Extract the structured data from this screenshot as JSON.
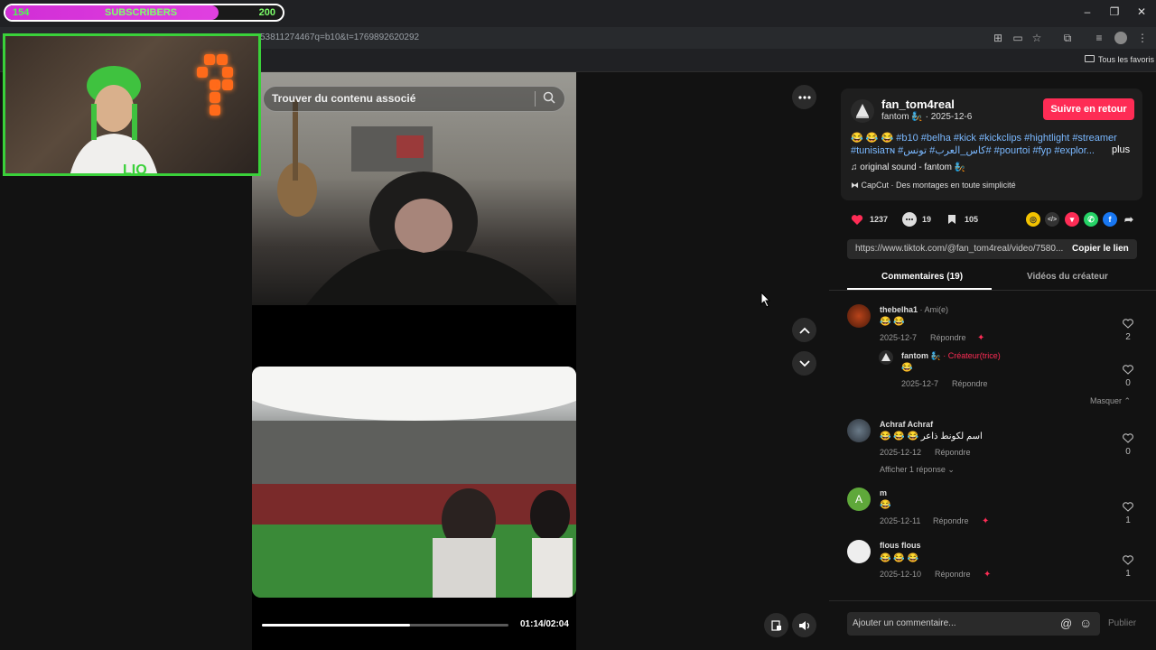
{
  "browser": {
    "url": "53811274467q=b10&t=1769892620292",
    "bookmarks_folder": "Tous les favoris"
  },
  "overlay": {
    "sub_count": "154",
    "sub_label": "SUBSCRIBERS",
    "sub_goal": "200",
    "sub_progress": 0.77
  },
  "search": {
    "placeholder": "Trouver du contenu associé"
  },
  "player": {
    "timecode": "01:14/02:04",
    "progress": 0.6
  },
  "post": {
    "author_name": "fan_tom4real",
    "author_display": "fantom 🧞 · 2025-12-6",
    "follow_label": "Suivre en retour",
    "desc_line1": "😂 😂 😂 #b10 #belha #kick #kickclips #hightlight #streamer",
    "desc_line2": "#tunisiaᴛɴ #كاس_العرب# تونس# #pourtoi #fyp #explor...",
    "more_label": "plus",
    "music": "original sound - fantom 🧞",
    "capcut": "CapCut · Des montages en toute simplicité",
    "likes": "1237",
    "comments": "19",
    "saves": "105",
    "link": "https://www.tiktok.com/@fan_tom4real/video/7580...",
    "copy_label": "Copier le lien"
  },
  "tabs": {
    "comments": "Commentaires (19)",
    "videos": "Vidéos du créateur"
  },
  "comments": [
    {
      "name": "thebelha1",
      "tag": " · Ami(e)",
      "text": "😂 😂",
      "date": "2025-12-7",
      "reply": "Répondre",
      "likes": "2"
    },
    {
      "name": "fantom 🧞",
      "tag": " · Créateur(trice)",
      "text": "😂",
      "date": "2025-12-7",
      "reply": "Répondre",
      "likes": "0"
    },
    {
      "name": "Achraf Achraf",
      "tag": "",
      "text": "😂 😂 😂 اسم لكونط ذاعر",
      "date": "2025-12-12",
      "reply": "Répondre",
      "likes": "0"
    },
    {
      "name": "m",
      "tag": "",
      "text": "😂",
      "date": "2025-12-11",
      "reply": "Répondre",
      "likes": "1"
    },
    {
      "name": "flous flous",
      "tag": "",
      "text": "😂 😂 😂",
      "date": "2025-12-10",
      "reply": "Répondre",
      "likes": "1"
    }
  ],
  "hide_label": "Masquer",
  "show_replies": "Afficher 1 réponse",
  "avatar_m_letter": "A",
  "comment_input": {
    "placeholder": "Ajouter un commentaire...",
    "publish": "Publier"
  },
  "colors": {
    "follow": "#fe2c55",
    "creator_tag": "#fe2c55",
    "hashtag": "#7ab8ff",
    "overlay_border": "#3ad13a"
  }
}
